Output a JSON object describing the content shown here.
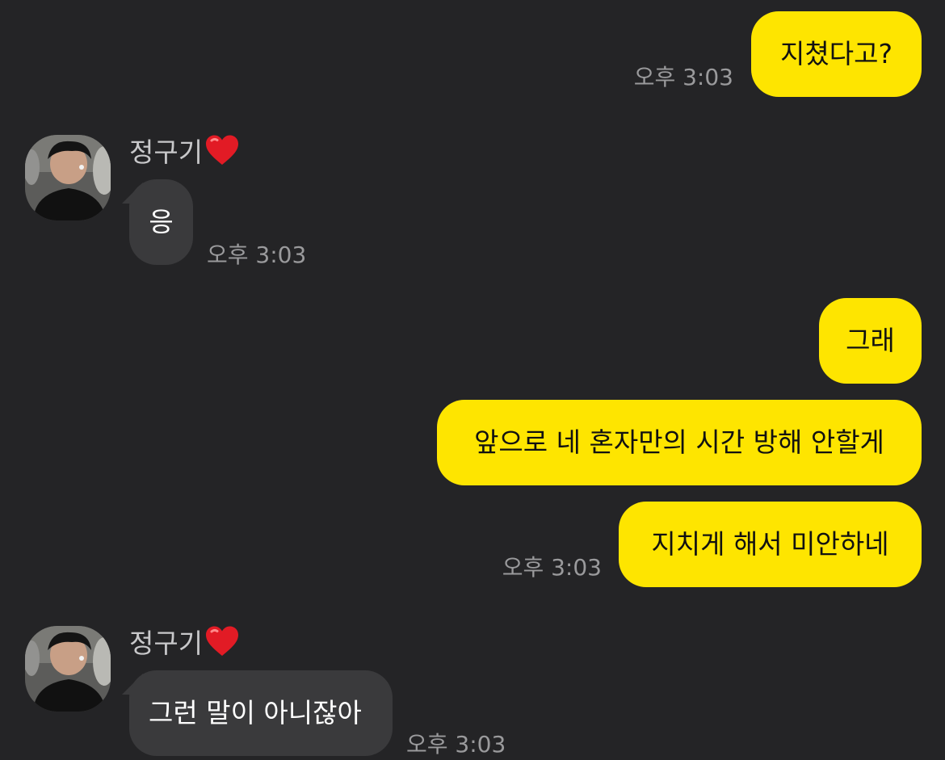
{
  "chat": {
    "contact_name": "정구기",
    "colors": {
      "background": "#242426",
      "my_bubble": "#fee500",
      "their_bubble": "#3a3a3c",
      "timestamp": "#9a9a9c"
    },
    "messages": [
      {
        "from": "me",
        "text": "지쳤다고?",
        "time": "오후 3:03"
      },
      {
        "from": "them",
        "text": "응",
        "time": "오후 3:03"
      },
      {
        "from": "me",
        "text": "그래"
      },
      {
        "from": "me",
        "text": "앞으로 네 혼자만의 시간 방해 안할게"
      },
      {
        "from": "me",
        "text": "지치게 해서 미안하네",
        "time": "오후 3:03"
      },
      {
        "from": "them",
        "text": "그런 말이 아니잖아",
        "time": "오후 3:03"
      }
    ],
    "sender_badge_icon": "red-heart-icon"
  }
}
